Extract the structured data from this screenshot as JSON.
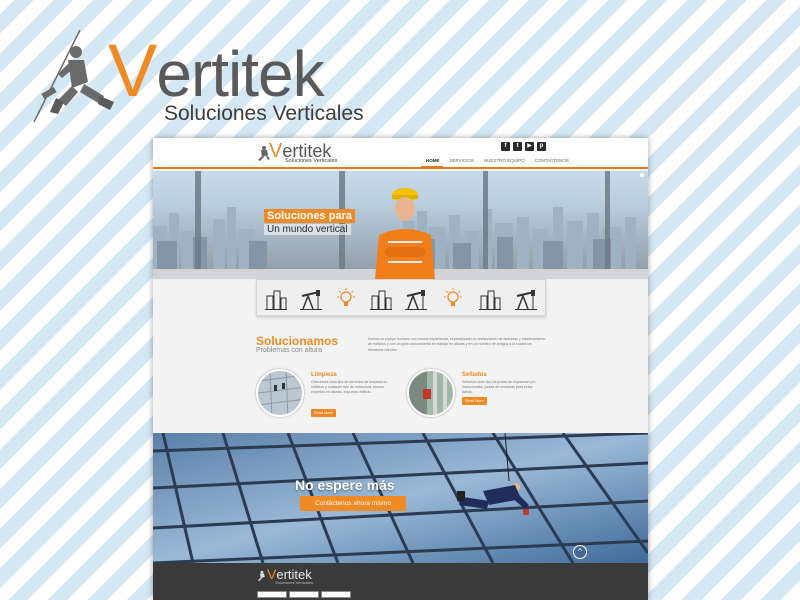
{
  "brand": {
    "name_initial": "V",
    "name_rest": "ertitek",
    "tagline": "Soluciones Verticales"
  },
  "colors": {
    "accent": "#ef8a24",
    "brand_gray": "#5a5a5a",
    "footer": "#3a3a3a",
    "stripe": "#d4e7f4"
  },
  "site": {
    "nav": {
      "logo_initial": "V",
      "logo_rest": "ertitek",
      "logo_tagline": "Soluciones Verticales",
      "social_icons": [
        "facebook-icon",
        "twitter-icon",
        "youtube-icon",
        "pinterest-icon"
      ],
      "social_glyphs": [
        "f",
        "t",
        "▶",
        "p"
      ],
      "menu": [
        "Home",
        "Servicios",
        "Nuestro Equipo",
        "Contactenos"
      ]
    },
    "hero": {
      "title_line1": "Soluciones para",
      "title_line2": "Un mundo vertical"
    },
    "icon_strip": [
      "building-icon",
      "oil-pump-icon",
      "lightbulb-icon",
      "building-icon",
      "oil-pump-icon",
      "lightbulb-icon",
      "building-icon",
      "oil-pump-icon"
    ],
    "about": {
      "title": "Solucionamos",
      "subtitle": "Problemas con altura",
      "text": "Somos un equipo humano con mucha experiencia, especializado en restauración de fachadas y mantenimiento de edificios y con un gran conocimiento en trabajo en alturas y en un número de amigos a lo cuales les llamamos clientes."
    },
    "services": [
      {
        "title": "Limpieza",
        "text": "Ofrecemos todo tipo de servicios de limpieza en edificios y cualquier tipo de estructura, somos expertos en alturas. Impuesto edificio...",
        "button": "Read More"
      },
      {
        "title": "Sellados",
        "text": "Sellamos todo tipo de juntas de expansión y/o estructurales, juntas de ventanas para evitar daños.",
        "button": "Read More"
      }
    ],
    "cta": {
      "title": "No espere más",
      "button": "Contáctenos ahora mismo",
      "scroll_glyph": "^"
    },
    "footer": {
      "logo_initial": "V",
      "logo_rest": "ertitek",
      "logo_tagline": "Soluciones Verticales"
    }
  }
}
